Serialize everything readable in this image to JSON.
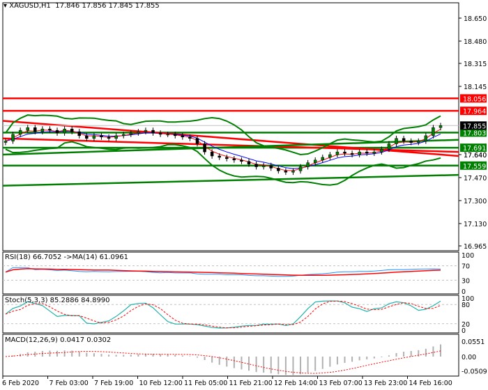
{
  "header": {
    "symbol": "XAGUSD,H1",
    "ohlc": "17.846 17.856 17.845 17.855"
  },
  "chart_data": {
    "type": "candlestick",
    "symbol": "XAGUSD",
    "timeframe": "H1",
    "ylim": [
      16.965,
      18.72
    ],
    "y_ticks": [
      "18.650",
      "18.480",
      "18.315",
      "18.145",
      "17.640",
      "17.470",
      "17.300",
      "17.130",
      "16.965"
    ],
    "x_ticks": [
      "6 Feb 2020",
      "7 Feb 03:00",
      "7 Feb 19:00",
      "10 Feb 12:00",
      "11 Feb 05:00",
      "11 Feb 21:00",
      "12 Feb 14:00",
      "13 Feb 07:00",
      "13 Feb 23:00",
      "14 Feb 16:00"
    ],
    "closes": [
      17.74,
      17.79,
      17.82,
      17.84,
      17.81,
      17.83,
      17.82,
      17.8,
      17.83,
      17.81,
      17.78,
      17.76,
      17.78,
      17.77,
      17.76,
      17.78,
      17.79,
      17.8,
      17.81,
      17.82,
      17.8,
      17.79,
      17.79,
      17.78,
      17.77,
      17.76,
      17.72,
      17.66,
      17.63,
      17.62,
      17.61,
      17.6,
      17.59,
      17.57,
      17.55,
      17.56,
      17.54,
      17.52,
      17.51,
      17.52,
      17.55,
      17.58,
      17.6,
      17.62,
      17.64,
      17.66,
      17.65,
      17.64,
      17.66,
      17.65,
      17.66,
      17.68,
      17.72,
      17.76,
      17.74,
      17.73,
      17.74,
      17.78,
      17.84,
      17.855
    ],
    "levels": [
      {
        "value": "18.056",
        "color": "#ff0000"
      },
      {
        "value": "17.964",
        "color": "#ff0000"
      },
      {
        "value": "17.803",
        "color": "#008000"
      },
      {
        "value": "17.691",
        "color": "#008000"
      },
      {
        "value": "17.559",
        "color": "#008000"
      }
    ],
    "current_price": "17.855",
    "trend_label": "17.640",
    "trendlines": [
      {
        "color": "#ff0000",
        "from": 17.89,
        "to": 17.63
      },
      {
        "color": "#ff0000",
        "from": 17.76,
        "to": 17.66
      },
      {
        "color": "#008000",
        "from": 17.41,
        "to": 17.49
      },
      {
        "color": "#008000",
        "from": 17.64,
        "to": 17.75
      }
    ],
    "rsi": {
      "label": "RSI(18) 66.7052  ->MA(14) 61.0961",
      "levels": [
        "100",
        "70",
        "30",
        "0"
      ]
    },
    "stoch": {
      "label": "Stoch(5,3,3) 85.2886 84.8990",
      "levels": [
        "100",
        "80",
        "20",
        "0"
      ]
    },
    "macd": {
      "label": "MACD(12,26,9) 0.0417 0.0302",
      "levels": [
        "0.0551",
        "0.00",
        "-0.0509"
      ]
    }
  }
}
